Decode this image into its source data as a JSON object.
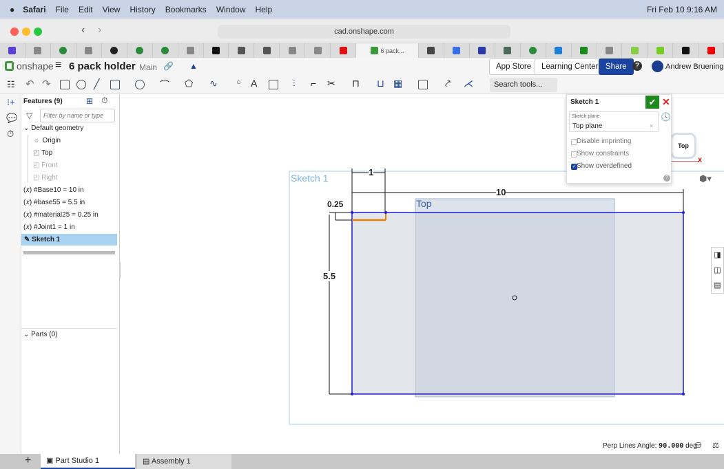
{
  "menubar": {
    "app": "Safari",
    "items": [
      "File",
      "Edit",
      "View",
      "History",
      "Bookmarks",
      "Window",
      "Help"
    ],
    "clock": "Fri Feb 10  9:16 AM"
  },
  "browser": {
    "url": "cad.onshape.com",
    "active_tab": "6 pack..."
  },
  "header": {
    "brand": "onshape",
    "doc_title": "6 pack holder",
    "branch": "Main",
    "app_store": "App Store",
    "learning_center": "Learning Center",
    "share": "Share",
    "user": "Andrew Bruening",
    "search_tools": "Search tools...",
    "shortcut": [
      "⌥",
      "C"
    ]
  },
  "features": {
    "title": "Features (9)",
    "filter_placeholder": "Filter by name or type",
    "group": "Default geometry",
    "geometry": [
      {
        "label": "Origin",
        "icon": "origin-icon",
        "dim": false
      },
      {
        "label": "Top",
        "icon": "plane-icon",
        "dim": false
      },
      {
        "label": "Front",
        "icon": "plane-icon",
        "dim": true
      },
      {
        "label": "Right",
        "icon": "plane-icon",
        "dim": true
      }
    ],
    "variables": [
      "#Base10 = 10 in",
      "#base55 = 5.5 in",
      "#material25 = 0.25 in",
      "#Joint1 = 1 in"
    ],
    "var_icon": "(𝑥)",
    "selected": "Sketch 1",
    "parts": "Parts (0)"
  },
  "sketch_dialog": {
    "title": "Sketch 1",
    "plane_label": "Sketch plane",
    "plane_value": "Top plane",
    "options": [
      {
        "label": "Disable imprinting",
        "checked": false
      },
      {
        "label": "Show constraints",
        "checked": false
      },
      {
        "label": "Show overdefined",
        "checked": true
      }
    ]
  },
  "viewport": {
    "sketch_label": "Sketch 1",
    "plane_label": "Top",
    "view_cube": "Top",
    "axis": "X",
    "dims": {
      "width": "10",
      "height": "5.5",
      "joint": "1",
      "material": "0.25"
    }
  },
  "status": {
    "label": "Perp Lines Angle:",
    "value": "90.000",
    "unit": "deg"
  },
  "tabs_bottom": [
    {
      "label": "Part Studio 1",
      "active": true
    },
    {
      "label": "Assembly 1",
      "active": false
    }
  ],
  "colors": {
    "accent": "#1a44a0",
    "sketch_blue": "#1c1cd6",
    "constraint_orange": "#e67e00",
    "selected": "#a8d2f0",
    "confirm": "#1e8a1e"
  }
}
